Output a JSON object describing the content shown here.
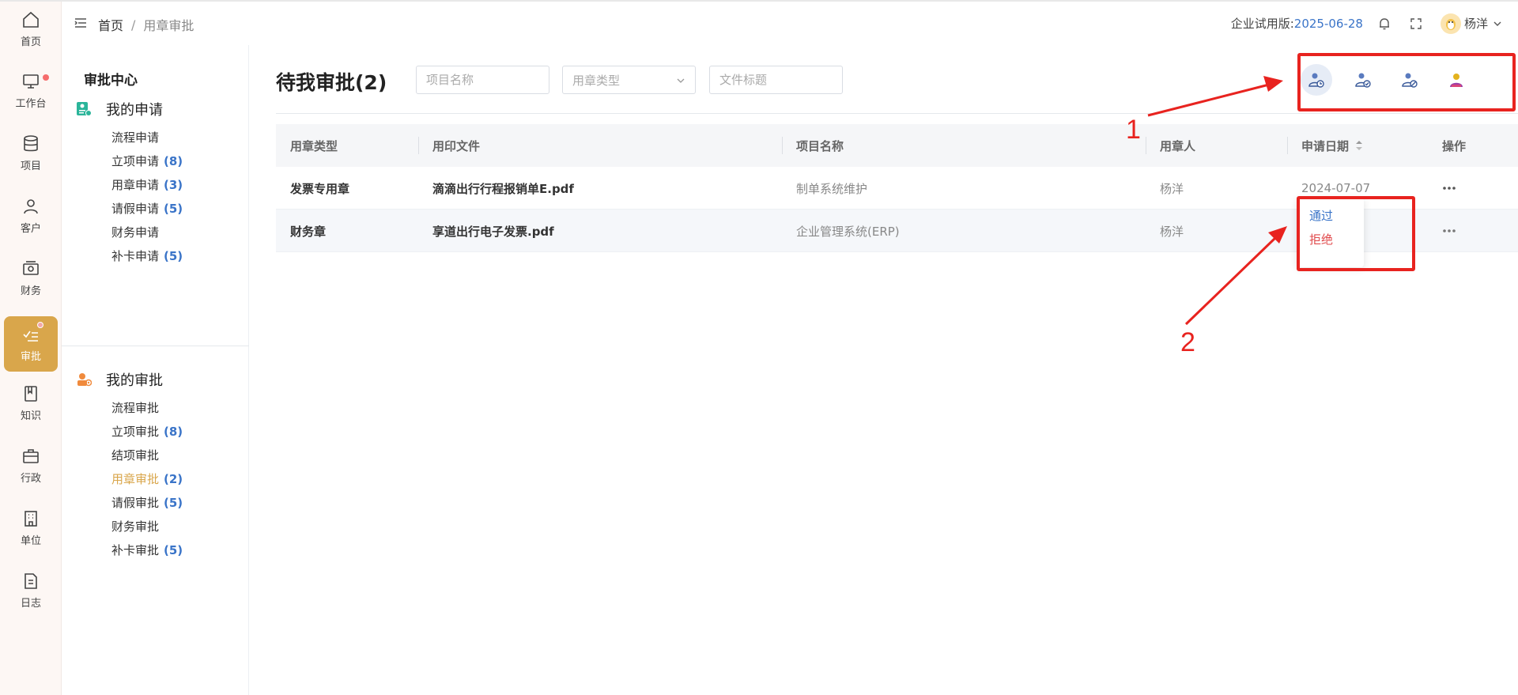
{
  "nav_rail": [
    {
      "label": "首页",
      "icon": "home-icon"
    },
    {
      "label": "工作台",
      "icon": "monitor-icon",
      "dot": true
    },
    {
      "label": "项目",
      "icon": "database-icon"
    },
    {
      "label": "客户",
      "icon": "user-icon"
    },
    {
      "label": "财务",
      "icon": "wallet-icon"
    },
    {
      "label": "审批",
      "icon": "checklist-icon",
      "active": true,
      "dot": true
    },
    {
      "label": "知识",
      "icon": "book-icon"
    },
    {
      "label": "行政",
      "icon": "briefcase-icon"
    },
    {
      "label": "单位",
      "icon": "building-icon"
    },
    {
      "label": "日志",
      "icon": "document-icon"
    }
  ],
  "header": {
    "breadcrumb": {
      "home": "首页",
      "separator": "/",
      "current": "用章审批"
    },
    "trial_label": "企业试用版:",
    "trial_date": "2025-06-28",
    "username": "杨洋"
  },
  "sidebar": {
    "title": "审批中心",
    "my_requests": {
      "heading": "我的申请",
      "items": [
        {
          "label": "流程申请",
          "count": ""
        },
        {
          "label": "立项申请",
          "count": "(8)"
        },
        {
          "label": "用章申请",
          "count": "(3)"
        },
        {
          "label": "请假申请",
          "count": "(5)"
        },
        {
          "label": "财务申请",
          "count": ""
        },
        {
          "label": "补卡申请",
          "count": "(5)"
        }
      ]
    },
    "my_approvals": {
      "heading": "我的审批",
      "items": [
        {
          "label": "流程审批",
          "count": ""
        },
        {
          "label": "立项审批",
          "count": "(8)"
        },
        {
          "label": "结项审批",
          "count": ""
        },
        {
          "label": "用章审批",
          "count": "(2)",
          "active": true
        },
        {
          "label": "请假审批",
          "count": "(5)"
        },
        {
          "label": "财务审批",
          "count": ""
        },
        {
          "label": "补卡审批",
          "count": "(5)"
        }
      ]
    }
  },
  "main": {
    "title": "待我审批(2)",
    "filters": {
      "project_placeholder": "项目名称",
      "seal_type_placeholder": "用章类型",
      "doc_title_placeholder": "文件标题"
    },
    "table": {
      "columns": [
        "用章类型",
        "用印文件",
        "项目名称",
        "用章人",
        "申请日期",
        "操作"
      ],
      "rows": [
        {
          "seal_type": "发票专用章",
          "file": "滴滴出行行程报销单E.pdf",
          "project": "制单系统维护",
          "user": "杨洋",
          "date": "2024-07-07"
        },
        {
          "seal_type": "财务章",
          "file": "享道出行电子发票.pdf",
          "project": "企业管理系统(ERP)",
          "user": "杨洋",
          "date": ""
        }
      ]
    },
    "action_menu": {
      "approve": "通过",
      "reject": "拒绝"
    }
  },
  "annotations": {
    "label_1": "1",
    "label_2": "2"
  },
  "colors": {
    "accent": "#d9a64b",
    "link": "#3a74c8",
    "danger": "#e0484a",
    "annotation": "#e8231f"
  }
}
